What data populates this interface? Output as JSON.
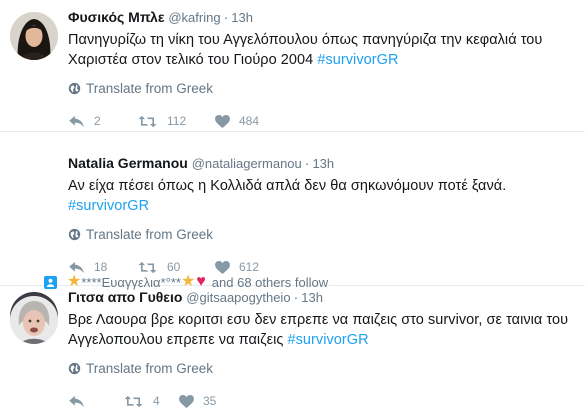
{
  "translate_label": "Translate from Greek",
  "colors": {
    "link": "#1da1f2",
    "muted": "#657786",
    "icon": "#8899a6"
  },
  "tweets": [
    {
      "fullname": "Φυσικός Μπλε",
      "handle": "@kafring",
      "time": "13h",
      "text": "Πανηγυρίζω τη νίκη του Αγγελόπουλου όπως πανηγύριζα την κεφαλιά του Χαριστέα στον τελικό του Γιούρο 2004",
      "hashtag": "#survivorGR",
      "replies": "2",
      "retweets": "112",
      "likes": "484",
      "avatar_icon": "woman-portrait-avatar"
    },
    {
      "social_context": {
        "prefix_icon": "star",
        "name": "****Ευαγγελια*°**",
        "suffix_icons": [
          "star",
          "red-heart"
        ],
        "text": "and 68 others follow"
      },
      "fullname": "Natalia Germanou",
      "handle": "@nataliagermanou",
      "time": "13h",
      "text": "Αν είχα πέσει όπως η Κολλιδά απλά δεν θα σηκωνόμουν ποτέ ξανά.",
      "hashtag": "#survivorGR",
      "replies": "18",
      "retweets": "60",
      "likes": "612",
      "avatar_icon": "woman-portrait-avatar"
    },
    {
      "fullname": "Γιτσα απο Γυθειο",
      "handle": "@gitsaapogytheio",
      "time": "13h",
      "text": "Βρε Λαουρα βρε κοριτσι εσυ δεν επρεπε να παιζεις στο survivor, σε ταινια του Αγγελοπουλου επρεπε να παιζεις",
      "hashtag": "#survivorGR",
      "replies": "",
      "retweets": "4",
      "likes": "35",
      "avatar_icon": "elderly-woman-avatar"
    }
  ]
}
